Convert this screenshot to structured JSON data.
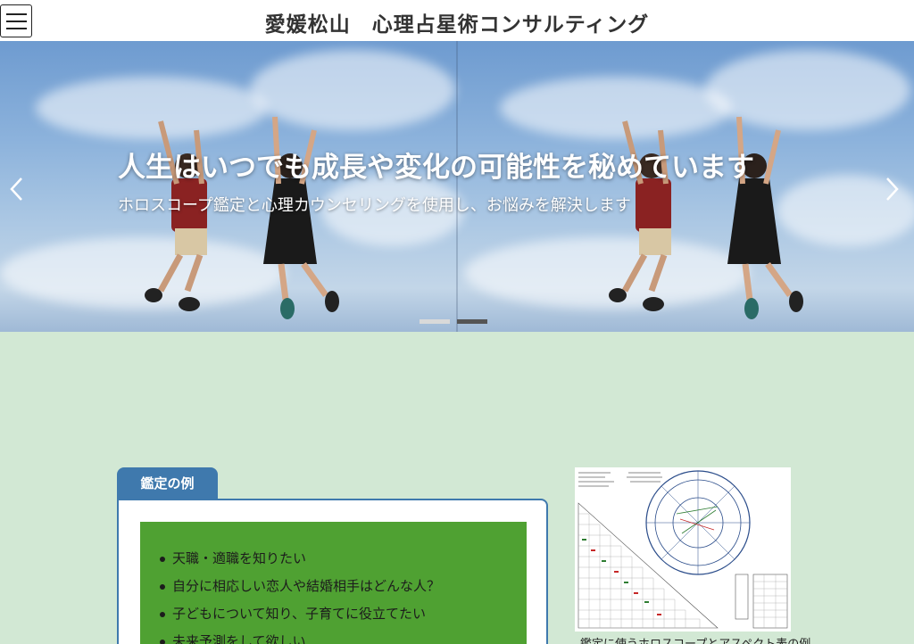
{
  "header": {
    "title": "愛媛松山　心理占星術コンサルティング",
    "menu_icon": "hamburger-menu-icon"
  },
  "hero": {
    "headline": "人生はいつでも成長や変化の可能性を秘めています",
    "subtext": "ホロスコープ鑑定と心理カウンセリングを使用し、お悩みを解決します",
    "prev_icon": "chevron-left-icon",
    "next_icon": "chevron-right-icon",
    "slides": [
      {
        "active": false
      },
      {
        "active": true
      }
    ],
    "indicator_active_color": "#555555",
    "indicator_inactive_color": "#d9d9d9"
  },
  "examples": {
    "tab_label": "鑑定の例",
    "items": [
      "天職・適職を知りたい",
      "自分に相応しい恋人や結婚相手はどんな人？",
      "子どもについて知り、子育てに役立てたい",
      "未来予測をして欲しい"
    ],
    "accent_color": "#3f79ad",
    "panel_color": "#4fa132"
  },
  "figure": {
    "caption": "鑑定に使うホロスコープとアスペクト表の例"
  },
  "colors": {
    "page_background": "#d2e8d4",
    "header_background": "#ffffff"
  }
}
